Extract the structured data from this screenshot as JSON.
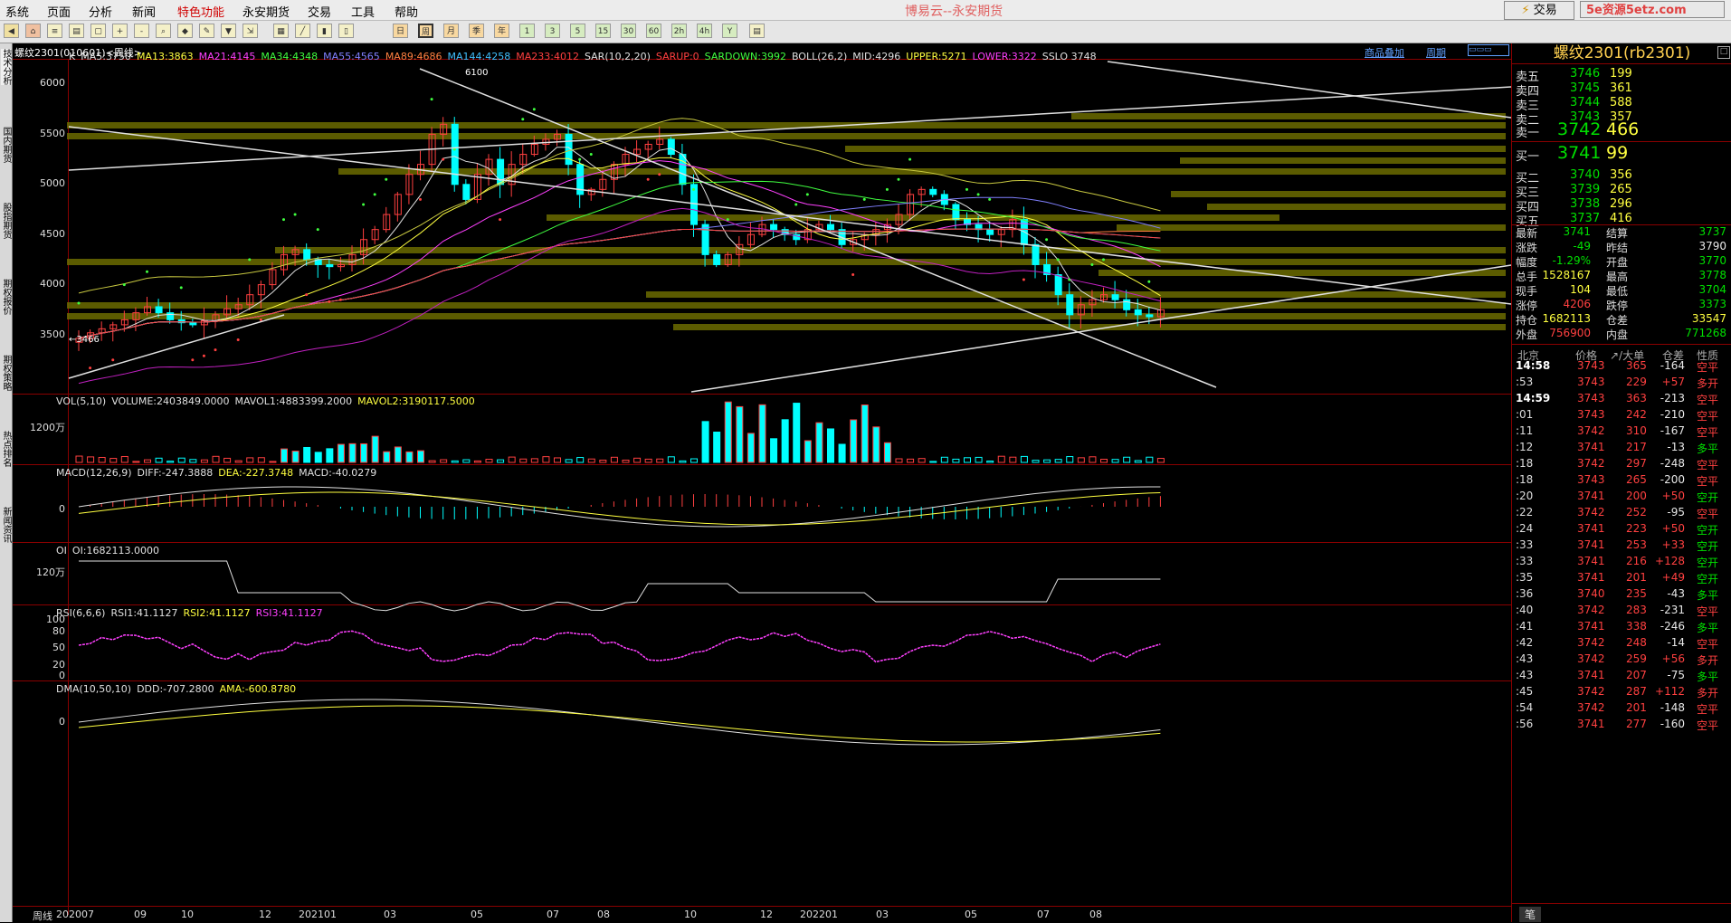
{
  "menu": {
    "items": [
      "系统",
      "页面",
      "分析",
      "新闻",
      "特色功能",
      "永安期货",
      "交易",
      "工具",
      "帮助"
    ],
    "highlight": "特色功能"
  },
  "app_title": "博易云--永安期货",
  "trade_button": "交易",
  "watermark": "5e资源5etz.com",
  "toolbar": {
    "periods": [
      "日",
      "周",
      "月",
      "季",
      "年",
      "1",
      "3",
      "5",
      "15",
      "30",
      "60",
      "2h",
      "4h",
      "Y"
    ]
  },
  "left_tabs": [
    "技术分析",
    "国内期货",
    "股指期货",
    "期权报价",
    "期权策略",
    "热点排名",
    "新闻资讯"
  ],
  "chart": {
    "title": "螺纹2301(010601)<周线>",
    "links": [
      "商品叠加",
      "周期"
    ],
    "kline_indicators": [
      {
        "text": "K",
        "color": "#e0e0e0"
      },
      {
        "text": "MA5:3750",
        "color": "#e0e0e0"
      },
      {
        "text": "MA13:3863",
        "color": "#ffff40"
      },
      {
        "text": "MA21:4145",
        "color": "#ff40ff"
      },
      {
        "text": "MA34:4348",
        "color": "#40ff40"
      },
      {
        "text": "MA55:4565",
        "color": "#8080ff"
      },
      {
        "text": "MA89:4686",
        "color": "#ff8040"
      },
      {
        "text": "MA144:4258",
        "color": "#40c0ff"
      },
      {
        "text": "MA233:4012",
        "color": "#ff4040"
      },
      {
        "text": "SAR(10,2,20)",
        "color": "#e0e0e0"
      },
      {
        "text": "SARUP:0",
        "color": "#ff4040"
      },
      {
        "text": "SARDOWN:3992",
        "color": "#40ff40"
      },
      {
        "text": "BOLL(26,2)",
        "color": "#e0e0e0"
      },
      {
        "text": "MID:4296",
        "color": "#e0e0e0"
      },
      {
        "text": "UPPER:5271",
        "color": "#ffff40"
      },
      {
        "text": "LOWER:3322",
        "color": "#ff40ff"
      },
      {
        "text": "SSLO 3748",
        "color": "#e0e0e0"
      }
    ],
    "price_ticks": [
      "6000",
      "5500",
      "5000",
      "4500",
      "4000",
      "3500"
    ],
    "annotations": {
      "high": "6100",
      "low": "3466"
    },
    "vol": {
      "label": "VOL(5,10)",
      "items": [
        {
          "text": "VOLUME:2403849.0000",
          "color": "#e0e0e0"
        },
        {
          "text": "MAVOL1:4883399.2000",
          "color": "#e0e0e0"
        },
        {
          "text": "MAVOL2:3190117.5000",
          "color": "#ffff40"
        }
      ],
      "tick": "1200万"
    },
    "macd": {
      "label": "MACD(12,26,9)",
      "items": [
        {
          "text": "DIFF:-247.3888",
          "color": "#e0e0e0"
        },
        {
          "text": "DEA:-227.3748",
          "color": "#ffff40"
        },
        {
          "text": "MACD:-40.0279",
          "color": "#e0e0e0"
        }
      ],
      "tick": "0"
    },
    "oi": {
      "label": "OI",
      "items": [
        {
          "text": "OI:1682113.0000",
          "color": "#e0e0e0"
        }
      ],
      "tick": "120万"
    },
    "rsi": {
      "label": "RSI(6,6,6)",
      "items": [
        {
          "text": "RSI1:41.1127",
          "color": "#e0e0e0"
        },
        {
          "text": "RSI2:41.1127",
          "color": "#ffff40"
        },
        {
          "text": "RSI3:41.1127",
          "color": "#ff40ff"
        }
      ],
      "ticks": [
        "100",
        "80",
        "50",
        "20",
        "0"
      ]
    },
    "dma": {
      "label": "DMA(10,50,10)",
      "items": [
        {
          "text": "DDD:-707.2800",
          "color": "#e0e0e0"
        },
        {
          "text": "AMA:-600.8780",
          "color": "#ffff40"
        }
      ],
      "tick": "0"
    },
    "x_axis": {
      "period_label": "周线",
      "labels": [
        "202007",
        "09",
        "10",
        "12",
        "202101",
        "03",
        "05",
        "07",
        "08",
        "10",
        "12",
        "202201",
        "03",
        "05",
        "07",
        "08"
      ]
    }
  },
  "quote": {
    "contract": "螺纹2301(rb2301)",
    "asks": [
      {
        "label": "卖五",
        "price": "3746",
        "vol": "199"
      },
      {
        "label": "卖四",
        "price": "3745",
        "vol": "361"
      },
      {
        "label": "卖三",
        "price": "3744",
        "vol": "588"
      },
      {
        "label": "卖二",
        "price": "3743",
        "vol": "357"
      },
      {
        "label": "卖一",
        "price": "3742",
        "vol": "466"
      }
    ],
    "bids": [
      {
        "label": "买一",
        "price": "3741",
        "vol": "99"
      },
      {
        "label": "买二",
        "price": "3740",
        "vol": "356"
      },
      {
        "label": "买三",
        "price": "3739",
        "vol": "265"
      },
      {
        "label": "买四",
        "price": "3738",
        "vol": "296"
      },
      {
        "label": "买五",
        "price": "3737",
        "vol": "416"
      }
    ],
    "stats": [
      {
        "l1": "最新",
        "v1": "3741",
        "c1": "green",
        "l2": "结算",
        "v2": "3737",
        "c2": "green"
      },
      {
        "l1": "涨跌",
        "v1": "-49",
        "c1": "green",
        "l2": "昨结",
        "v2": "3790",
        "c2": "white"
      },
      {
        "l1": "幅度",
        "v1": "-1.29%",
        "c1": "green",
        "l2": "开盘",
        "v2": "3770",
        "c2": "green"
      },
      {
        "l1": "总手",
        "v1": "1528167",
        "c1": "yellow",
        "l2": "最高",
        "v2": "3778",
        "c2": "green"
      },
      {
        "l1": "现手",
        "v1": "104",
        "c1": "yellow",
        "l2": "最低",
        "v2": "3704",
        "c2": "green"
      },
      {
        "l1": "涨停",
        "v1": "4206",
        "c1": "red",
        "l2": "跌停",
        "v2": "3373",
        "c2": "green"
      },
      {
        "l1": "持仓",
        "v1": "1682113",
        "c1": "yellow",
        "l2": "仓差",
        "v2": "33547",
        "c2": "yellow"
      },
      {
        "l1": "外盘",
        "v1": "756900",
        "c1": "red",
        "l2": "内盘",
        "v2": "771268",
        "c2": "green"
      }
    ],
    "tick_header": {
      "time": "北京",
      "price": "价格",
      "vol": "↗/大单",
      "oi": "仓差",
      "nature": "性质"
    },
    "ticks": [
      {
        "t": "14:58",
        "p": "3743",
        "v": "365",
        "d": "-164",
        "n": "空平",
        "nc": "red"
      },
      {
        "t": ":53",
        "p": "3743",
        "v": "229",
        "d": "+57",
        "n": "多开",
        "nc": "red"
      },
      {
        "t": "14:59",
        "p": "3743",
        "v": "363",
        "d": "-213",
        "n": "空平",
        "nc": "red"
      },
      {
        "t": ":01",
        "p": "3743",
        "v": "242",
        "d": "-210",
        "n": "空平",
        "nc": "red"
      },
      {
        "t": ":11",
        "p": "3742",
        "v": "310",
        "d": "-167",
        "n": "空平",
        "nc": "red"
      },
      {
        "t": ":12",
        "p": "3741",
        "v": "217",
        "d": "-13",
        "n": "多平",
        "nc": "green"
      },
      {
        "t": ":18",
        "p": "3742",
        "v": "297",
        "d": "-248",
        "n": "空平",
        "nc": "red"
      },
      {
        "t": ":18",
        "p": "3743",
        "v": "265",
        "d": "-200",
        "n": "空平",
        "nc": "red"
      },
      {
        "t": ":20",
        "p": "3741",
        "v": "200",
        "d": "+50",
        "n": "空开",
        "nc": "green"
      },
      {
        "t": ":22",
        "p": "3742",
        "v": "252",
        "d": "-95",
        "n": "空平",
        "nc": "red"
      },
      {
        "t": ":24",
        "p": "3741",
        "v": "223",
        "d": "+50",
        "n": "空开",
        "nc": "green"
      },
      {
        "t": ":33",
        "p": "3741",
        "v": "253",
        "d": "+33",
        "n": "空开",
        "nc": "green"
      },
      {
        "t": ":33",
        "p": "3741",
        "v": "216",
        "d": "+128",
        "n": "空开",
        "nc": "green"
      },
      {
        "t": ":35",
        "p": "3741",
        "v": "201",
        "d": "+49",
        "n": "空开",
        "nc": "green"
      },
      {
        "t": ":36",
        "p": "3740",
        "v": "235",
        "d": "-43",
        "n": "多平",
        "nc": "green"
      },
      {
        "t": ":40",
        "p": "3742",
        "v": "283",
        "d": "-231",
        "n": "空平",
        "nc": "red"
      },
      {
        "t": ":41",
        "p": "3741",
        "v": "338",
        "d": "-246",
        "n": "多平",
        "nc": "green"
      },
      {
        "t": ":42",
        "p": "3742",
        "v": "248",
        "d": "-14",
        "n": "空平",
        "nc": "red"
      },
      {
        "t": ":43",
        "p": "3742",
        "v": "259",
        "d": "+56",
        "n": "多开",
        "nc": "red"
      },
      {
        "t": ":43",
        "p": "3741",
        "v": "207",
        "d": "-75",
        "n": "多平",
        "nc": "green"
      },
      {
        "t": ":45",
        "p": "3742",
        "v": "287",
        "d": "+112",
        "n": "多开",
        "nc": "red"
      },
      {
        "t": ":54",
        "p": "3742",
        "v": "201",
        "d": "-148",
        "n": "空平",
        "nc": "red"
      },
      {
        "t": ":56",
        "p": "3741",
        "v": "277",
        "d": "-160",
        "n": "空平",
        "nc": "red"
      }
    ],
    "footer_tab": "笔"
  }
}
